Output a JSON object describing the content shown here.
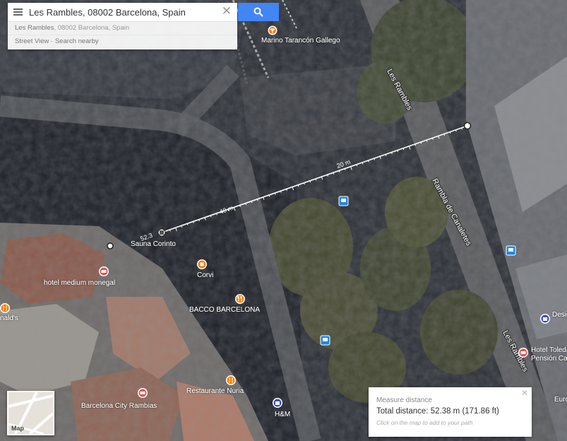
{
  "search": {
    "query": "Les Rambles, 08002 Barcelona, Spain",
    "suggestion_main": "Les Rambles",
    "suggestion_rest": ", 08002 Barcelona, Spain",
    "actions": "Street View · Search nearby"
  },
  "places": [
    {
      "name": "Marino Tarancón Gallego",
      "icon": "bar-icon"
    },
    {
      "name": "Sauna Corinto",
      "icon": "place-icon"
    },
    {
      "name": "hotel medium monegal",
      "icon": "hotel-icon"
    },
    {
      "name": "Corvi",
      "icon": "shop-icon"
    },
    {
      "name": "BACCO BARCELONA",
      "icon": "restaurant-icon"
    },
    {
      "name": "nald's",
      "icon": "restaurant-icon"
    },
    {
      "name": "Restaurante Nuria",
      "icon": "restaurant-icon"
    },
    {
      "name": "Barcelona City Rambias",
      "icon": "hotel-icon"
    },
    {
      "name": "H&M",
      "icon": "shopping-icon"
    },
    {
      "name": "Hotel Toleda",
      "icon": "hotel-icon"
    },
    {
      "name": "Pensión Cap",
      "icon": "hotel-icon"
    },
    {
      "name": "Desig",
      "icon": "shopping-icon"
    },
    {
      "name": "Euro",
      "icon": "hotel-icon"
    }
  ],
  "streets": [
    "Les Rambles",
    "Rambla de Canaletes",
    "Les Rambles"
  ],
  "ruler": {
    "labels": [
      "20 m",
      "40 m",
      "52.3"
    ]
  },
  "measure": {
    "title": "Measure distance",
    "total": "Total distance: 52.38 m (171.86 ft)",
    "hint": "Click on the map to add to your path"
  },
  "maptype": {
    "label": "Map"
  },
  "colors": {
    "accent": "#4285f4",
    "bus": "#1e88e5",
    "food": "#f57c00"
  }
}
